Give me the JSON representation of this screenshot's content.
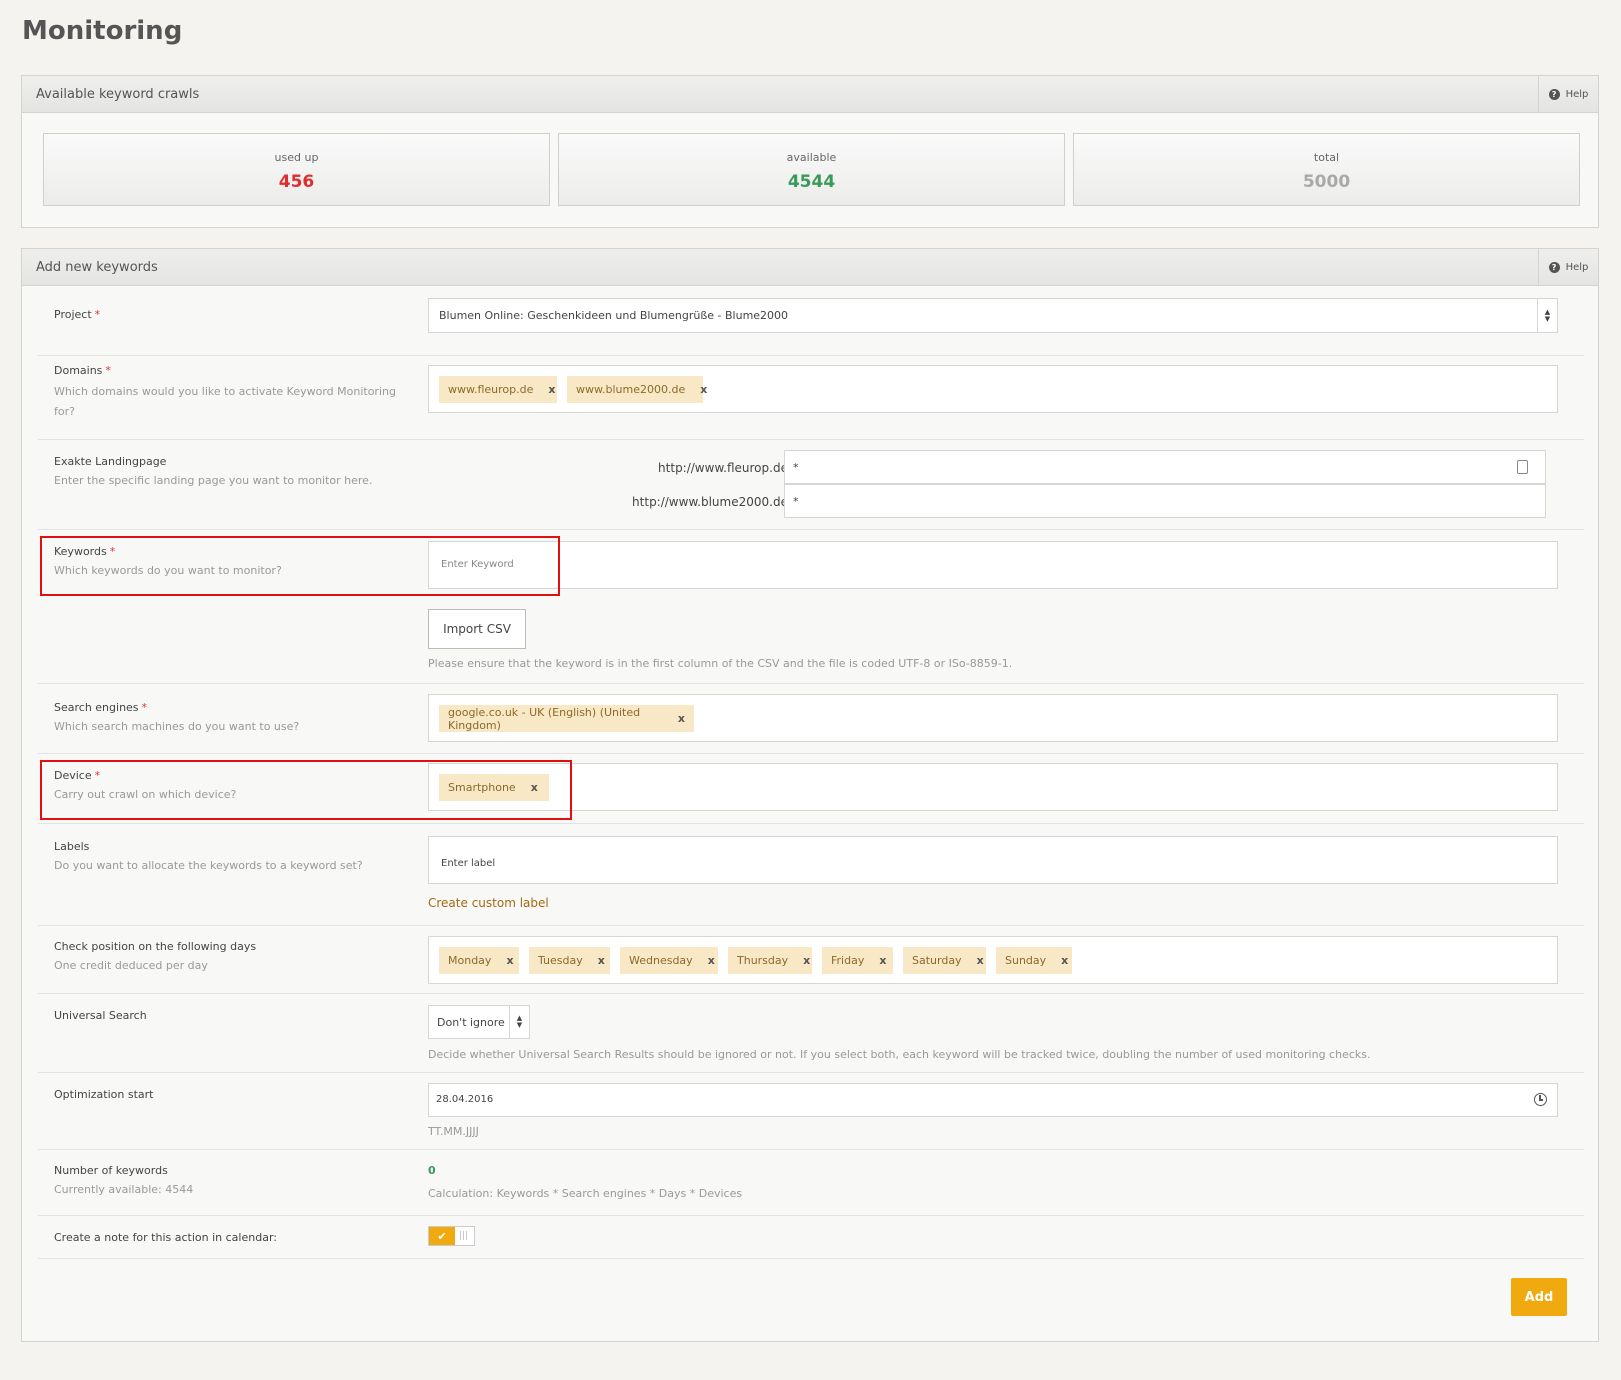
{
  "page": {
    "title": "Monitoring"
  },
  "crawls": {
    "title": "Available keyword crawls",
    "help": "Help",
    "stats": [
      {
        "label": "used up",
        "value": "456",
        "color": "#e02d2d"
      },
      {
        "label": "available",
        "value": "4544",
        "color": "#3a9a5a"
      },
      {
        "label": "total",
        "value": "5000",
        "color": "#a9a9a9"
      }
    ]
  },
  "form": {
    "title": "Add new keywords",
    "help": "Help",
    "project": {
      "label": "Project",
      "required": "*",
      "value": "Blumen Online: Geschenkideen und Blumengrüße - Blume2000"
    },
    "domains": {
      "label": "Domains",
      "required": "*",
      "description": "Which domains would you like to activate Keyword Monitoring for?",
      "tags": [
        "www.fleurop.de",
        "www.blume2000.de"
      ]
    },
    "landing": {
      "label": "Exakte Landingpage",
      "description": "Enter the specific landing page you want to monitor here.",
      "rows": [
        {
          "prefix": "http://www.fleurop.de/",
          "value": "*"
        },
        {
          "prefix": "http://www.blume2000.de/",
          "value": "*"
        }
      ]
    },
    "keywords": {
      "label": "Keywords",
      "required": "*",
      "description": "Which keywords do you want to monitor?",
      "placeholder": "Enter Keyword",
      "import_label": "Import CSV",
      "import_hint": "Please ensure that the keyword is in the first column of the CSV and the file is coded UTF-8 or ISo-8859-1."
    },
    "search_engines": {
      "label": "Search engines",
      "required": "*",
      "description": "Which search machines do you want to use?",
      "tags": [
        "google.co.uk - UK (English) (United Kingdom)"
      ]
    },
    "device": {
      "label": "Device",
      "required": "*",
      "description": "Carry out crawl on which device?",
      "tags": [
        "Smartphone"
      ]
    },
    "labels": {
      "label": "Labels",
      "description": "Do you want to allocate the keywords to a keyword set?",
      "placeholder": "Enter label",
      "create_link": "Create custom label"
    },
    "days": {
      "label": "Check position on the following days",
      "description": "One credit deduced per day",
      "tags": [
        "Monday",
        "Tuesday",
        "Wednesday",
        "Thursday",
        "Friday",
        "Saturday",
        "Sunday"
      ]
    },
    "universal": {
      "label": "Universal Search",
      "value": "Don't ignore",
      "hint": "Decide whether Universal Search Results should be ignored or not. If you select both, each keyword will be tracked twice, doubling the number of used monitoring checks."
    },
    "optimization": {
      "label": "Optimization start",
      "value": "28.04.2016",
      "format_hint": "TT.MM.JJJJ"
    },
    "count": {
      "label": "Number of keywords",
      "description": "Currently available: 4544",
      "value": "0",
      "calc": "Calculation: Keywords * Search engines * Days * Devices"
    },
    "note": {
      "label": "Create a note for this action in calendar:",
      "checked": true
    },
    "add_label": "Add"
  },
  "x_mark": "x",
  "icons": {
    "help": "question-circle-icon",
    "sort": "sort-arrows-icon",
    "contact": "contact-card-icon",
    "clock": "clock-icon",
    "check": "check-icon"
  }
}
